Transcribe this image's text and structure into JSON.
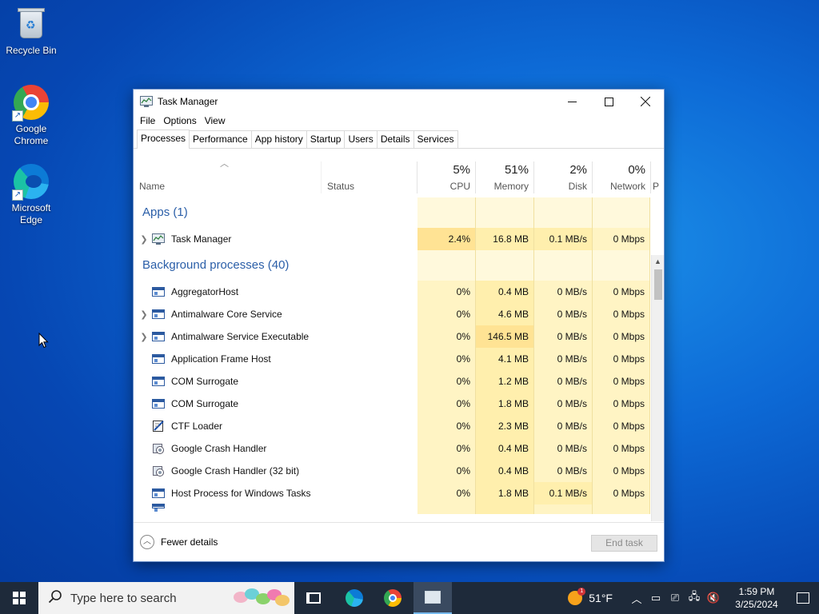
{
  "desktop": {
    "icons": [
      {
        "label": "Recycle Bin"
      },
      {
        "label": "Google Chrome"
      },
      {
        "label": "Microsoft Edge"
      }
    ]
  },
  "window": {
    "title": "Task Manager",
    "menu": [
      "File",
      "Options",
      "View"
    ],
    "tabs": [
      "Processes",
      "Performance",
      "App history",
      "Startup",
      "Users",
      "Details",
      "Services"
    ],
    "active_tab": "Processes",
    "columns": {
      "name": "Name",
      "status": "Status",
      "cpu": {
        "pct": "5%",
        "label": "CPU"
      },
      "memory": {
        "pct": "51%",
        "label": "Memory"
      },
      "disk": {
        "pct": "2%",
        "label": "Disk"
      },
      "network": {
        "pct": "0%",
        "label": "Network"
      },
      "power_partial": "P"
    },
    "groups": {
      "apps": "Apps (1)",
      "background": "Background processes (40)"
    },
    "apps": [
      {
        "name": "Task Manager",
        "cpu": "2.4%",
        "memory": "16.8 MB",
        "disk": "0.1 MB/s",
        "network": "0 Mbps",
        "expandable": true,
        "icon": "task-manager-icon"
      }
    ],
    "background": [
      {
        "name": "AggregatorHost",
        "cpu": "0%",
        "memory": "0.4 MB",
        "disk": "0 MB/s",
        "network": "0 Mbps",
        "expandable": false,
        "icon": "window-icon"
      },
      {
        "name": "Antimalware Core Service",
        "cpu": "0%",
        "memory": "4.6 MB",
        "disk": "0 MB/s",
        "network": "0 Mbps",
        "expandable": true,
        "icon": "window-icon"
      },
      {
        "name": "Antimalware Service Executable",
        "cpu": "0%",
        "memory": "146.5 MB",
        "disk": "0 MB/s",
        "network": "0 Mbps",
        "expandable": true,
        "icon": "window-icon"
      },
      {
        "name": "Application Frame Host",
        "cpu": "0%",
        "memory": "4.1 MB",
        "disk": "0 MB/s",
        "network": "0 Mbps",
        "expandable": false,
        "icon": "window-icon"
      },
      {
        "name": "COM Surrogate",
        "cpu": "0%",
        "memory": "1.2 MB",
        "disk": "0 MB/s",
        "network": "0 Mbps",
        "expandable": false,
        "icon": "window-icon"
      },
      {
        "name": "COM Surrogate",
        "cpu": "0%",
        "memory": "1.8 MB",
        "disk": "0 MB/s",
        "network": "0 Mbps",
        "expandable": false,
        "icon": "window-icon"
      },
      {
        "name": "CTF Loader",
        "cpu": "0%",
        "memory": "2.3 MB",
        "disk": "0 MB/s",
        "network": "0 Mbps",
        "expandable": false,
        "icon": "ctf-loader-icon"
      },
      {
        "name": "Google Crash Handler",
        "cpu": "0%",
        "memory": "0.4 MB",
        "disk": "0 MB/s",
        "network": "0 Mbps",
        "expandable": false,
        "icon": "crash-handler-icon"
      },
      {
        "name": "Google Crash Handler (32 bit)",
        "cpu": "0%",
        "memory": "0.4 MB",
        "disk": "0 MB/s",
        "network": "0 Mbps",
        "expandable": false,
        "icon": "crash-handler-icon"
      },
      {
        "name": "Host Process for Windows Tasks",
        "cpu": "0%",
        "memory": "1.8 MB",
        "disk": "0.1 MB/s",
        "network": "0 Mbps",
        "expandable": false,
        "icon": "window-icon"
      }
    ],
    "footer": {
      "fewer_details": "Fewer details",
      "end_task": "End task"
    }
  },
  "taskbar": {
    "search_placeholder": "Type here to search",
    "weather_temp": "51°F",
    "weather_badge": "1",
    "time": "1:59 PM",
    "date": "3/25/2024"
  },
  "colors": {
    "group_title": "#2a5ea8",
    "heat_light": "#fff9dc",
    "heat_1": "#fff4c4",
    "heat_2": "#ffefad",
    "heat_3": "#ffe394",
    "taskbar": "#1e2a3a"
  }
}
